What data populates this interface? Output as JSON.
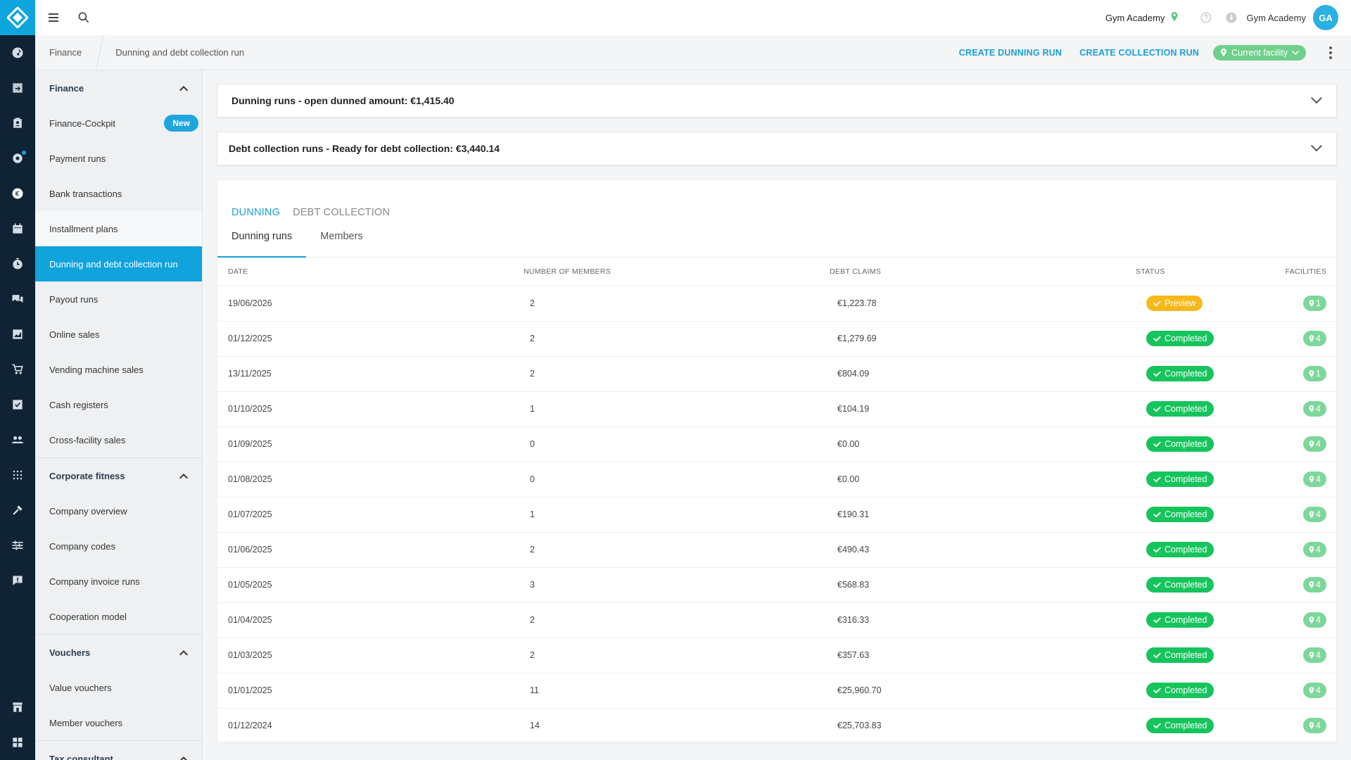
{
  "topbar": {
    "facility_name": "Gym Academy",
    "user_name": "Gym Academy",
    "avatar_initials": "GA"
  },
  "breadcrumb": {
    "parent": "Finance",
    "current": "Dunning and debt collection run"
  },
  "actions": {
    "create_dunning": "CREATE DUNNING RUN",
    "create_collection": "CREATE COLLECTION RUN",
    "facility_filter": "Current facility"
  },
  "sidebar": {
    "sections": [
      {
        "title": "Finance",
        "items": [
          {
            "label": "Finance-Cockpit",
            "badge": "New"
          },
          {
            "label": "Payment runs"
          },
          {
            "label": "Bank transactions"
          },
          {
            "label": "Installment plans"
          },
          {
            "label": "Dunning and debt collection run"
          },
          {
            "label": "Payout runs"
          },
          {
            "label": "Online sales"
          },
          {
            "label": "Vending machine sales"
          },
          {
            "label": "Cash registers"
          },
          {
            "label": "Cross-facility sales"
          }
        ]
      },
      {
        "title": "Corporate fitness",
        "items": [
          {
            "label": "Company overview"
          },
          {
            "label": "Company codes"
          },
          {
            "label": "Company invoice runs"
          },
          {
            "label": "Cooperation model"
          }
        ]
      },
      {
        "title": "Vouchers",
        "items": [
          {
            "label": "Value vouchers"
          },
          {
            "label": "Member vouchers"
          }
        ]
      },
      {
        "title": "Tax consultant",
        "items": []
      }
    ]
  },
  "summaries": {
    "dunning": "Dunning runs - open dunned amount: €1,415.40",
    "collection": "Debt collection runs - Ready for debt collection: €3,440.14"
  },
  "tabs": {
    "main": [
      "DUNNING",
      "DEBT COLLECTION"
    ],
    "sub": [
      "Dunning runs",
      "Members"
    ]
  },
  "table": {
    "headers": [
      "DATE",
      "NUMBER OF MEMBERS",
      "DEBT CLAIMS",
      "STATUS",
      "FACILITIES"
    ],
    "rows": [
      {
        "date": "19/06/2026",
        "members": "2",
        "claims": "€1,223.78",
        "status": "Preview",
        "facilities": "1"
      },
      {
        "date": "01/12/2025",
        "members": "2",
        "claims": "€1,279.69",
        "status": "Completed",
        "facilities": "4"
      },
      {
        "date": "13/11/2025",
        "members": "2",
        "claims": "€804.09",
        "status": "Completed",
        "facilities": "1"
      },
      {
        "date": "01/10/2025",
        "members": "1",
        "claims": "€104.19",
        "status": "Completed",
        "facilities": "4"
      },
      {
        "date": "01/09/2025",
        "members": "0",
        "claims": "€0.00",
        "status": "Completed",
        "facilities": "4"
      },
      {
        "date": "01/08/2025",
        "members": "0",
        "claims": "€0.00",
        "status": "Completed",
        "facilities": "4"
      },
      {
        "date": "01/07/2025",
        "members": "1",
        "claims": "€190.31",
        "status": "Completed",
        "facilities": "4"
      },
      {
        "date": "01/06/2025",
        "members": "2",
        "claims": "€490.43",
        "status": "Completed",
        "facilities": "4"
      },
      {
        "date": "01/05/2025",
        "members": "3",
        "claims": "€568.83",
        "status": "Completed",
        "facilities": "4"
      },
      {
        "date": "01/04/2025",
        "members": "2",
        "claims": "€316.33",
        "status": "Completed",
        "facilities": "4"
      },
      {
        "date": "01/03/2025",
        "members": "2",
        "claims": "€357.63",
        "status": "Completed",
        "facilities": "4"
      },
      {
        "date": "01/01/2025",
        "members": "11",
        "claims": "€25,960.70",
        "status": "Completed",
        "facilities": "4"
      },
      {
        "date": "01/12/2024",
        "members": "14",
        "claims": "€25,703.83",
        "status": "Completed",
        "facilities": "4"
      }
    ]
  },
  "colors": {
    "accent": "#1a9fd5",
    "rail": "#102334",
    "completed": "#16c45c",
    "preview": "#f5b91c",
    "facility_pill": "#7ed79a"
  },
  "icons": {
    "rail": [
      "dashboard-icon",
      "checkin-icon",
      "contacts-icon",
      "settings-cog-icon",
      "euro-icon",
      "calendar-icon",
      "timer-icon",
      "chat-icon",
      "chart-icon",
      "cart-icon",
      "task-check-icon",
      "groups-icon",
      "devices-icon",
      "tools-icon",
      "sliders-icon",
      "feedback-icon"
    ],
    "rail_bottom": [
      "store-icon",
      "apps-grid-icon"
    ]
  }
}
